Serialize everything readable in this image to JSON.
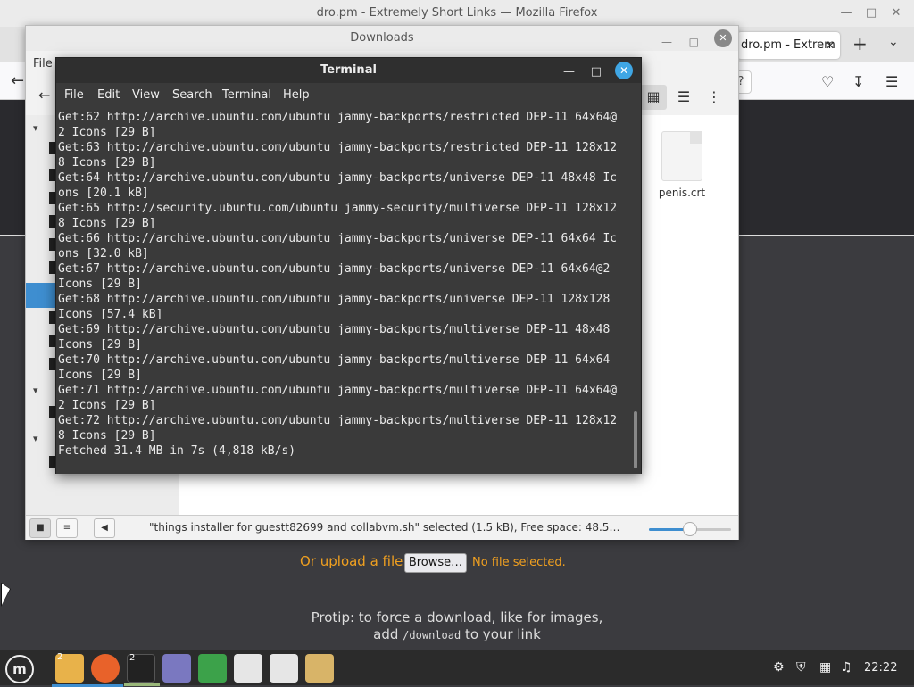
{
  "firefox": {
    "window_title": "dro.pm - Extremely Short Links — Mozilla Firefox",
    "tab_label": "dro.pm - Extrem",
    "new_tab": "+",
    "url_help": "?"
  },
  "page": {
    "upload_label": "Or upload a file:",
    "browse_label": "Browse…",
    "no_file": "No file selected.",
    "protip_line1": "Protip: to force a download, like for images,",
    "protip_add": "add",
    "protip_code": "/download",
    "protip_end": "to your link"
  },
  "downloads": {
    "title": "Downloads",
    "menu_file": "File",
    "file_name": "penis.crt",
    "status_text": "\"things installer for guestt82699 and collabvm.sh\" selected (1.5 kB), Free space: 48.5…",
    "zoom_level": 0.5
  },
  "terminal": {
    "title": "Terminal",
    "menu": [
      "File",
      "Edit",
      "View",
      "Search",
      "Terminal",
      "Help"
    ],
    "lines": [
      "Get:62 http://archive.ubuntu.com/ubuntu jammy-backports/restricted DEP-11 64x64@",
      "2 Icons [29 B]",
      "Get:63 http://archive.ubuntu.com/ubuntu jammy-backports/restricted DEP-11 128x12",
      "8 Icons [29 B]",
      "Get:64 http://archive.ubuntu.com/ubuntu jammy-backports/universe DEP-11 48x48 Ic",
      "ons [20.1 kB]",
      "Get:65 http://security.ubuntu.com/ubuntu jammy-security/multiverse DEP-11 128x12",
      "8 Icons [29 B]",
      "Get:66 http://archive.ubuntu.com/ubuntu jammy-backports/universe DEP-11 64x64 Ic",
      "ons [32.0 kB]",
      "Get:67 http://archive.ubuntu.com/ubuntu jammy-backports/universe DEP-11 64x64@2",
      "Icons [29 B]",
      "Get:68 http://archive.ubuntu.com/ubuntu jammy-backports/universe DEP-11 128x128",
      "Icons [57.4 kB]",
      "Get:69 http://archive.ubuntu.com/ubuntu jammy-backports/multiverse DEP-11 48x48",
      "Icons [29 B]",
      "Get:70 http://archive.ubuntu.com/ubuntu jammy-backports/multiverse DEP-11 64x64",
      "Icons [29 B]",
      "Get:71 http://archive.ubuntu.com/ubuntu jammy-backports/multiverse DEP-11 64x64@",
      "2 Icons [29 B]",
      "Get:72 http://archive.ubuntu.com/ubuntu jammy-backports/multiverse DEP-11 128x12",
      "8 Icons [29 B]",
      "Fetched 31.4 MB in 7s (4,818 kB/s)"
    ]
  },
  "taskbar": {
    "files_badge": "2",
    "terminal_badge": "2",
    "clock": "22:22",
    "colors": {
      "accent": "#3e8ed0",
      "active_indicator": "#9ab87a",
      "link_orange": "#f0a020"
    }
  }
}
